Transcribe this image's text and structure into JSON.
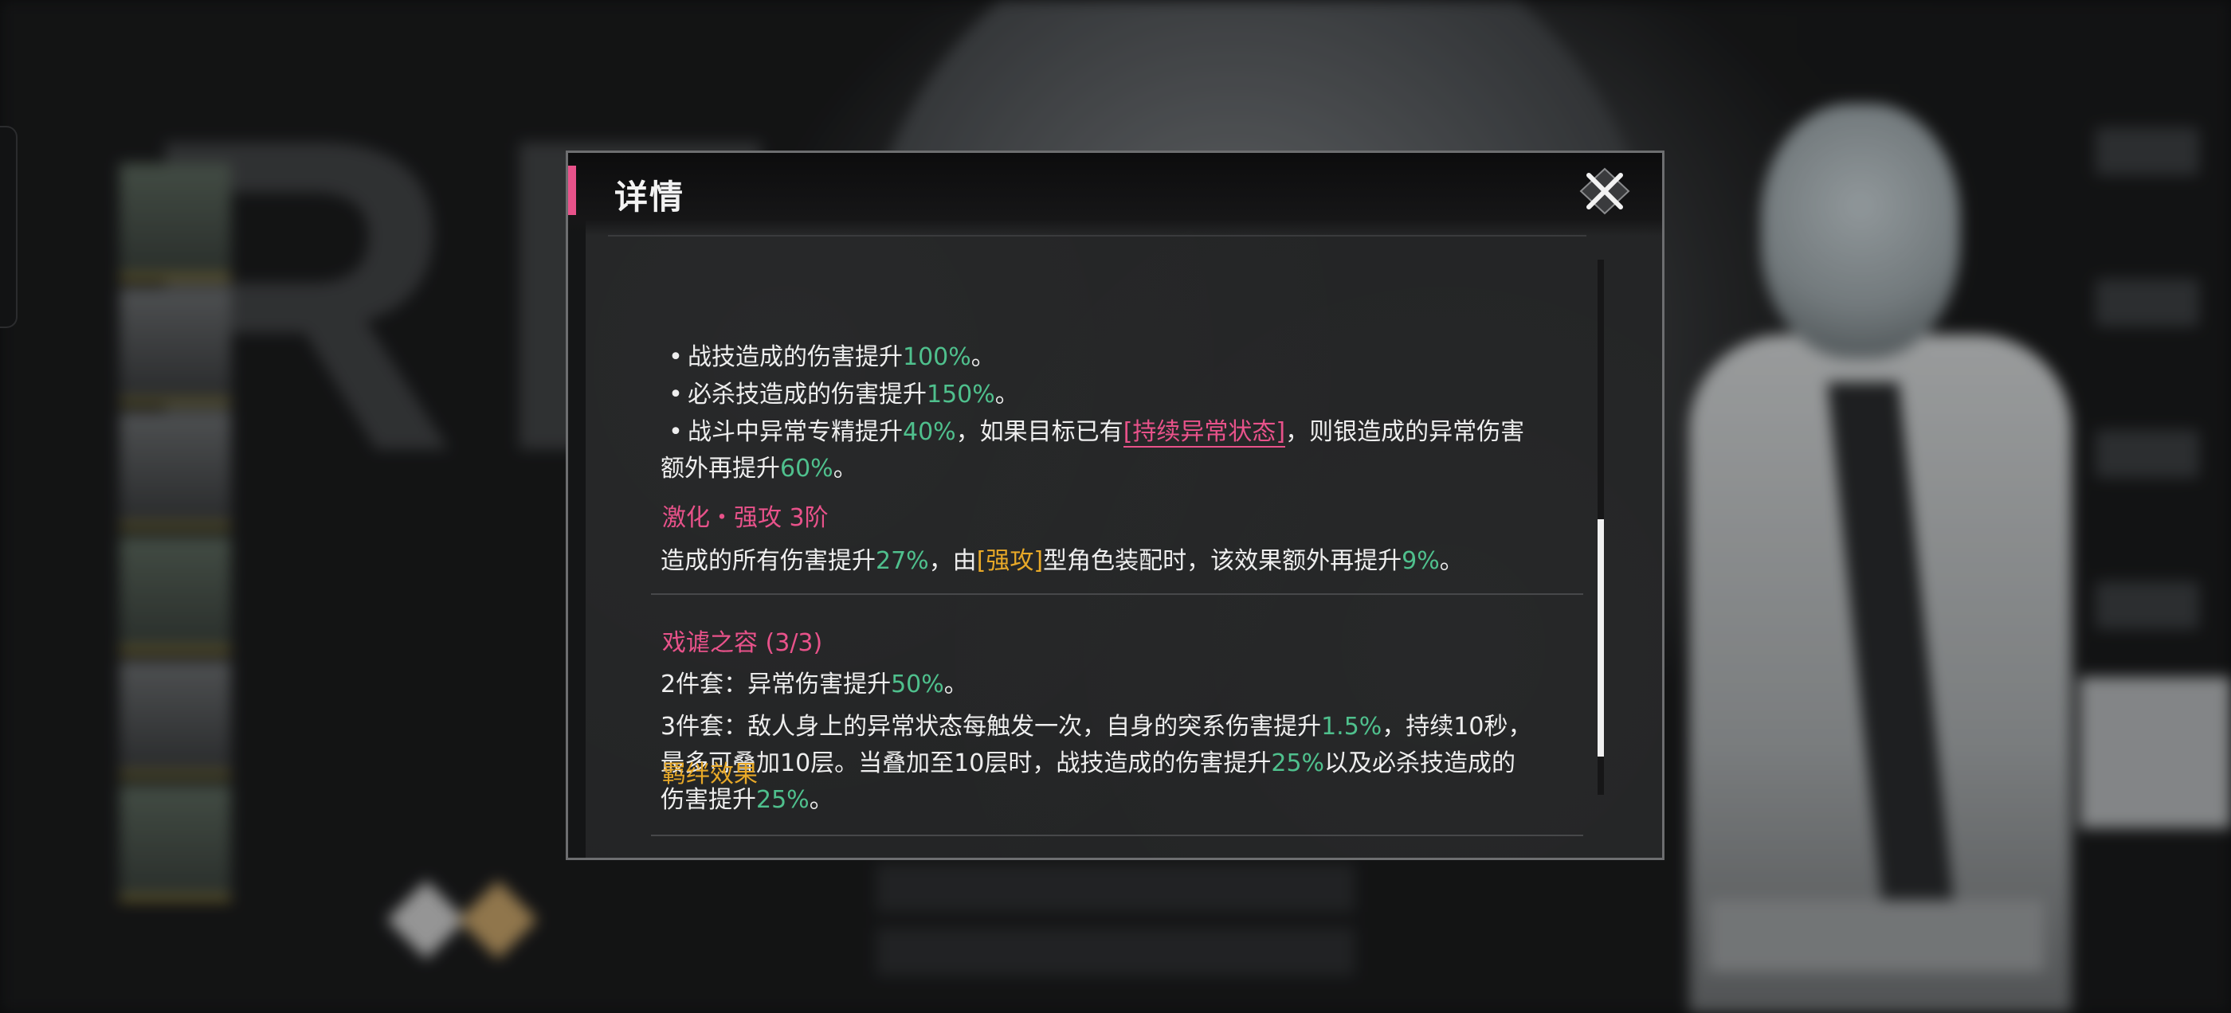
{
  "dialog": {
    "title": "详情",
    "close_icon": "close-x-icon",
    "accent_color": "#e8528a"
  },
  "skill_bonus": {
    "lines": [
      {
        "bullet": "•",
        "text_a": "战技造成的伤害提升",
        "value": "100%",
        "text_b": "。"
      },
      {
        "bullet": "•",
        "text_a": "必杀技造成的伤害提升",
        "value": "150%",
        "text_b": "。"
      }
    ],
    "line3": {
      "bullet": "•",
      "text_a": "战斗中异常专精提升",
      "value_a": "40%",
      "text_b": "，如果目标已有",
      "keyword": "[持续异常状态]",
      "text_c": "，则银造成的异常伤害"
    },
    "line4": {
      "text_a": "额外再提升",
      "value": "60%",
      "text_b": "。"
    }
  },
  "enhance": {
    "title": "激化・强攻 3阶",
    "desc_a": "造成的所有伤害提升",
    "value_a": "27%",
    "desc_b": "，由",
    "keyword": "[强攻]",
    "desc_c": "型角色装配时，该效果额外再提升",
    "value_b": "9%",
    "desc_d": "。"
  },
  "set": {
    "title": "戏谑之容 (3/3)",
    "two_piece": {
      "text_a": "2件套：异常伤害提升",
      "value": "50%",
      "text_b": "。"
    },
    "three_piece": {
      "line1_a": "3件套：敌人身上的异常状态每触发一次，自身的突系伤害提升",
      "line1_value": "1.5%",
      "line1_b": "，持续10秒，",
      "line2_a": "最多可叠加10层。当叠加至10层时，战技造成的伤害提升",
      "line2_value": "25%",
      "line2_b": "以及必杀技造成的",
      "line3_a": "伤害提升",
      "line3_value": "25%",
      "line3_b": "。"
    }
  },
  "bond": {
    "title": "羁绊效果"
  },
  "colors": {
    "value_green": "#4fc08d",
    "keyword_pink": "#e8528a",
    "keyword_gold": "#e8a928",
    "text_white": "#eeeeee"
  }
}
